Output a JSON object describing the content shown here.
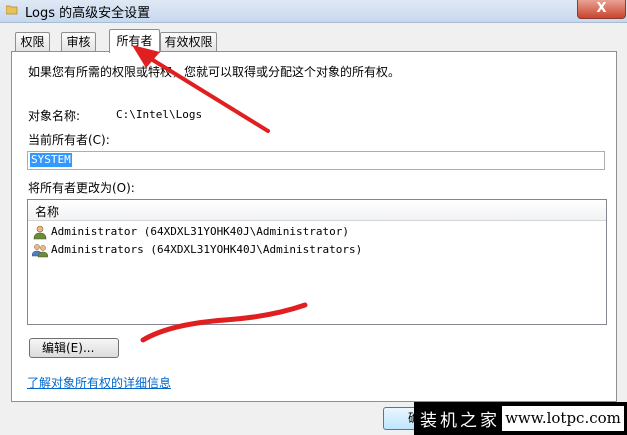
{
  "window": {
    "title": "Logs 的高级安全设置",
    "close_label": "X"
  },
  "tabs": [
    {
      "label": "权限"
    },
    {
      "label": "审核"
    },
    {
      "label": "所有者"
    },
    {
      "label": "有效权限"
    }
  ],
  "panel": {
    "intro": "如果您有所需的权限或特权，您就可以取得或分配这个对象的所有权。",
    "object_name_label": "对象名称:",
    "object_name_value": "C:\\Intel\\Logs",
    "current_owner_label": "当前所有者(C):",
    "current_owner_value": "SYSTEM",
    "change_owner_label": "将所有者更改为(O):",
    "list_header": "名称",
    "owners": [
      {
        "name": "Administrator (64XDXL31YOHK40J\\Administrator)",
        "icon": "user-icon"
      },
      {
        "name": "Administrators (64XDXL31YOHK40J\\Administrators)",
        "icon": "users-group-icon"
      }
    ],
    "edit_button": "编辑(E)...",
    "learn_more_link": "了解对象所有权的详细信息"
  },
  "footer": {
    "ok_button": "确定"
  },
  "watermark": {
    "left_text": "装机之家",
    "right_text": "www.lotpc.com"
  },
  "colors": {
    "annotation_red": "#e02020",
    "selection_blue": "#3399ff",
    "link_blue": "#0066cc"
  }
}
